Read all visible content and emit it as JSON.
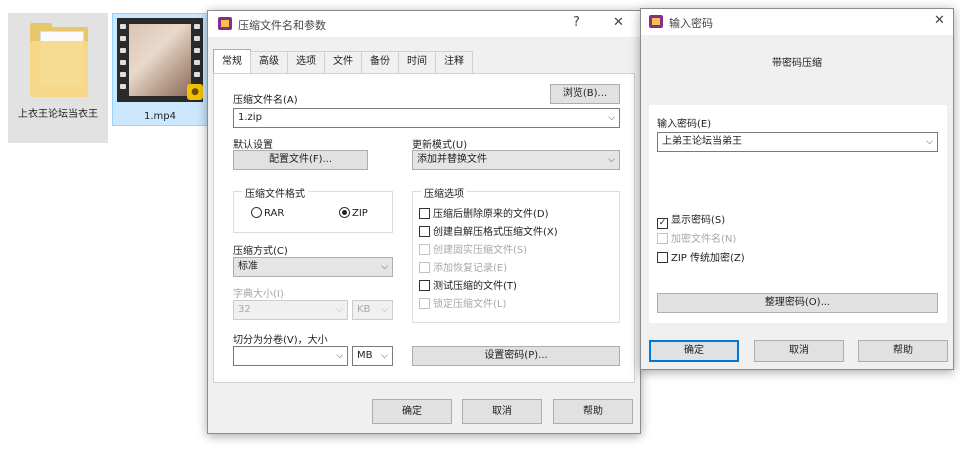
{
  "desktop": {
    "folder_label": "上衣王论坛当衣王",
    "video_label": "1.mp4"
  },
  "main_dialog": {
    "title": "压缩文件名和参数",
    "help_symbol": "?",
    "close_symbol": "✕",
    "tabs": [
      {
        "label": "常规"
      },
      {
        "label": "高级"
      },
      {
        "label": "选项"
      },
      {
        "label": "文件"
      },
      {
        "label": "备份"
      },
      {
        "label": "时间"
      },
      {
        "label": "注释"
      }
    ],
    "archive_name_label": "压缩文件名(A)",
    "browse_button": "浏览(B)...",
    "archive_name_value": "1.zip",
    "default_settings_label": "默认设置",
    "profiles_button": "配置文件(F)...",
    "update_mode_label": "更新模式(U)",
    "update_mode_value": "添加并替换文件",
    "format_group_title": "压缩文件格式",
    "format_rar": "RAR",
    "format_zip": "ZIP",
    "options_group_title": "压缩选项",
    "options": [
      {
        "label": "压缩后删除原来的文件(D)",
        "checked": false,
        "enabled": true
      },
      {
        "label": "创建自解压格式压缩文件(X)",
        "checked": false,
        "enabled": true
      },
      {
        "label": "创建固实压缩文件(S)",
        "checked": false,
        "enabled": false
      },
      {
        "label": "添加恢复记录(E)",
        "checked": false,
        "enabled": false
      },
      {
        "label": "测试压缩的文件(T)",
        "checked": false,
        "enabled": true
      },
      {
        "label": "锁定压缩文件(L)",
        "checked": false,
        "enabled": false
      }
    ],
    "method_label": "压缩方式(C)",
    "method_value": "标准",
    "dict_label": "字典大小(I)",
    "dict_value": "32",
    "dict_unit": "KB",
    "split_label": "切分为分卷(V)，大小",
    "split_value": "",
    "split_unit": "MB",
    "set_password_button": "设置密码(P)...",
    "ok_button": "确定",
    "cancel_button": "取消",
    "help_button": "帮助"
  },
  "password_dialog": {
    "title": "输入密码",
    "close_symbol": "✕",
    "heading": "带密码压缩",
    "enter_label": "输入密码(E)",
    "password_value": "上弟王论坛当弟王",
    "show_password": {
      "label": "显示密码(S)",
      "checked": true,
      "enabled": true
    },
    "encrypt_names": {
      "label": "加密文件名(N)",
      "checked": false,
      "enabled": false
    },
    "zip_legacy": {
      "label": "ZIP 传统加密(Z)",
      "checked": false,
      "enabled": true
    },
    "organize_button": "整理密码(O)...",
    "ok_button": "确定",
    "cancel_button": "取消",
    "help_button": "帮助"
  },
  "icons": {
    "check_mark": "✓",
    "caret": "⌵"
  },
  "colors": {
    "accent": "#0078d7",
    "selection": "#cce8ff",
    "winrar_icon": "#8b2c8a"
  }
}
